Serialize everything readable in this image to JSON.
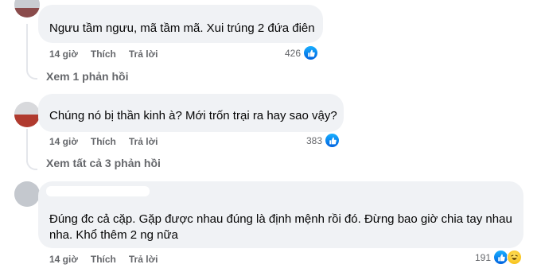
{
  "comments": [
    {
      "text": "Ngưu tầm ngưu, mã tầm mã. Xui trúng 2 đứa điên",
      "time": "14 giờ",
      "like_label": "Thích",
      "reply_label": "Trả lời",
      "reaction_count": "426",
      "reactions": [
        "like-icon"
      ],
      "view_replies": "Xem 1 phản hồi"
    },
    {
      "text": "Chúng nó bị thần kinh à? Mới trốn trại ra hay sao vậy?",
      "time": "14 giờ",
      "like_label": "Thích",
      "reply_label": "Trả lời",
      "reaction_count": "383",
      "reactions": [
        "like-icon"
      ],
      "view_replies": "Xem tất cả 3 phản hồi"
    },
    {
      "text_line1": "Đúng đc cả cặp. Gặp được nhau đúng là định mệnh rồi đó. Đừng bao giờ chia tay nhau",
      "text_line2": "nha. Khổ thêm 2 ng nữa",
      "time": "14 giờ",
      "like_label": "Thích",
      "reply_label": "Trả lời",
      "reaction_count": "191",
      "reactions": [
        "like-icon",
        "haha-icon"
      ]
    }
  ],
  "colors": {
    "bubble": "#f0f2f5",
    "meta_text": "#65676b",
    "like_blue": "#0866ff"
  }
}
